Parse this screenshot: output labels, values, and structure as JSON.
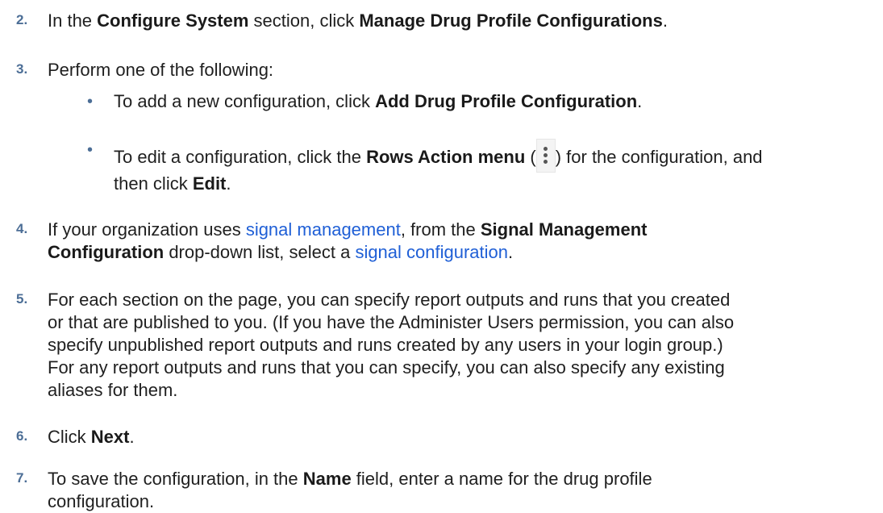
{
  "steps": [
    {
      "number": "2.",
      "parts": [
        "In the ",
        "Configure System",
        " section, click ",
        "Manage Drug Profile Configurations",
        "."
      ]
    },
    {
      "number": "3.",
      "text": "Perform one of the following:",
      "bullets": [
        {
          "parts": [
            "To add a new configuration, click ",
            "Add Drug Profile Configuration",
            "."
          ]
        },
        {
          "parts": [
            "To edit a configuration, click the ",
            "Rows Action menu",
            " (",
            ") for the configuration, and",
            "then click ",
            "Edit",
            "."
          ]
        }
      ]
    },
    {
      "number": "4.",
      "parts": [
        "If your organization uses ",
        "signal management",
        ", from the ",
        "Signal Management",
        "Configuration",
        " drop-down list, select a ",
        "signal configuration",
        "."
      ]
    },
    {
      "number": "5.",
      "lines": [
        "For each section on the page, you can specify report outputs and runs that you created",
        "or that are published to you. (If you have the Administer Users permission, you can also",
        "specify unpublished report outputs and runs created by any users in your login group.)",
        "For any report outputs and runs that you can specify, you can also specify any existing",
        "aliases for them."
      ]
    },
    {
      "number": "6.",
      "parts": [
        "Click ",
        "Next",
        "."
      ]
    },
    {
      "number": "7.",
      "parts": [
        "To save the configuration, in the ",
        "Name",
        " field, enter a name for the drug profile",
        "configuration."
      ]
    }
  ],
  "bullet_char": "•",
  "icons": {
    "rows_action": "kebab-menu-icon"
  },
  "colors": {
    "step_number": "#4c6e96",
    "link": "#1f5fd6",
    "text": "#1f1f1f"
  }
}
